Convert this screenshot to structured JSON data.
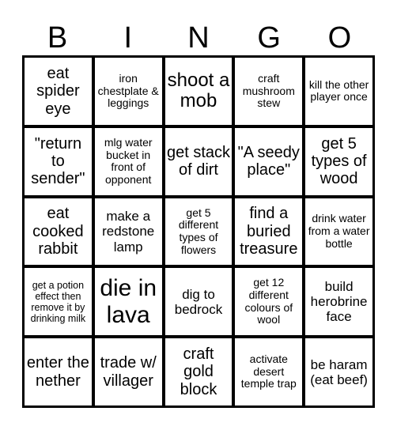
{
  "header": {
    "letters": [
      "B",
      "I",
      "N",
      "G",
      "O"
    ]
  },
  "board": {
    "cells": [
      "eat spider eye",
      "iron chestplate & leggings",
      "shoot a mob",
      "craft mushroom stew",
      "kill the other player once",
      "\"return to sender\"",
      "mlg water bucket in front of opponent",
      "get stack of dirt",
      "\"A seedy place\"",
      "get 5 types of wood",
      "eat cooked rabbit",
      "make a redstone lamp",
      "get 5 different types of flowers",
      "find a buried treasure",
      "drink water from a water bottle",
      "get a potion effect then remove it by drinking milk",
      "die in lava",
      "dig to bedrock",
      "get 12 different colours of wool",
      "build herobrine face",
      "enter the nether",
      "trade w/ villager",
      "craft gold block",
      "activate desert temple trap",
      "be haram (eat beef)"
    ]
  }
}
